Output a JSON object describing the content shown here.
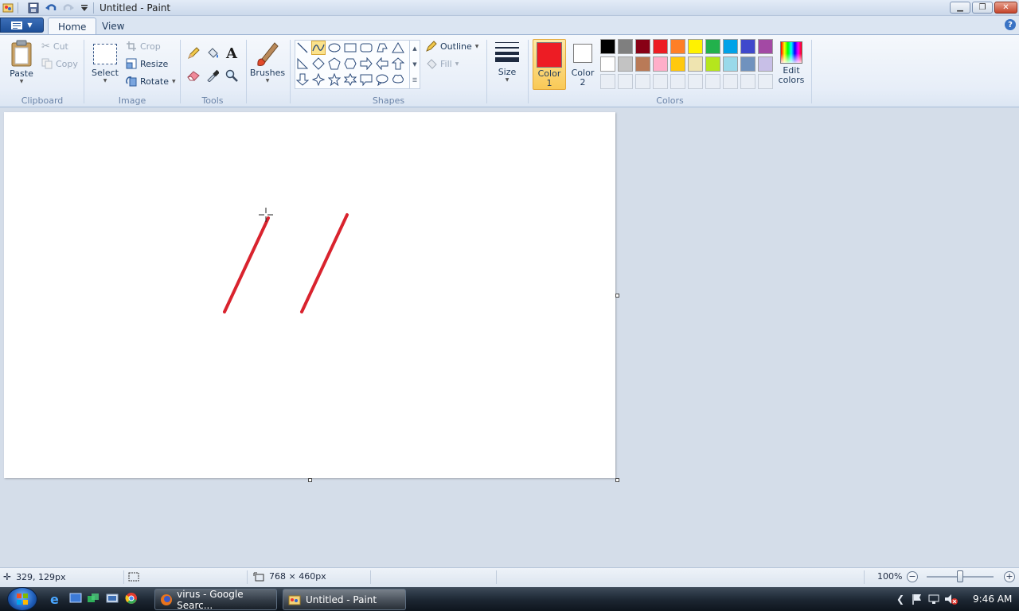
{
  "window": {
    "title": "Untitled - Paint"
  },
  "tabs": [
    {
      "label": "Home"
    },
    {
      "label": "View"
    }
  ],
  "clipboard": {
    "paste": "Paste",
    "cut": "Cut",
    "copy": "Copy",
    "group": "Clipboard"
  },
  "image": {
    "select": "Select",
    "crop": "Crop",
    "resize": "Resize",
    "rotate": "Rotate",
    "group": "Image"
  },
  "tools": {
    "group": "Tools",
    "items": [
      "pencil-icon",
      "fill-bucket-icon",
      "text-icon",
      "eraser-icon",
      "color-picker-icon",
      "magnifier-icon"
    ]
  },
  "brushes": {
    "label": "Brushes"
  },
  "shapes": {
    "group": "Shapes",
    "outline": "Outline",
    "fill": "Fill",
    "selected": "curve"
  },
  "size": {
    "label": "Size"
  },
  "colors": {
    "group": "Colors",
    "color1": {
      "label": "Color",
      "num": "1",
      "value": "#ed1c24"
    },
    "color2": {
      "label": "Color",
      "num": "2",
      "value": "#ffffff"
    },
    "edit_line1": "Edit",
    "edit_line2": "colors",
    "row1": [
      "#000000",
      "#7f7f7f",
      "#880015",
      "#ed1c24",
      "#ff7f27",
      "#fff200",
      "#22b14c",
      "#00a2e8",
      "#3f48cc",
      "#a349a4"
    ],
    "row2": [
      "#ffffff",
      "#c3c3c3",
      "#b97a57",
      "#ffaec9",
      "#ffc90e",
      "#efe4b0",
      "#b5e61d",
      "#99d9ea",
      "#7092be",
      "#c8bfe7"
    ]
  },
  "canvas": {
    "stroke_color": "#d9232e"
  },
  "status": {
    "cursor_pos": "329, 129px",
    "canvas_size": "768 × 460px",
    "zoom": "100%",
    "zoom_level": 1.0
  },
  "taskbar": {
    "items": [
      {
        "label": "virus - Google Searc..."
      },
      {
        "label": "Untitled - Paint"
      }
    ],
    "clock": "9:46 AM"
  }
}
